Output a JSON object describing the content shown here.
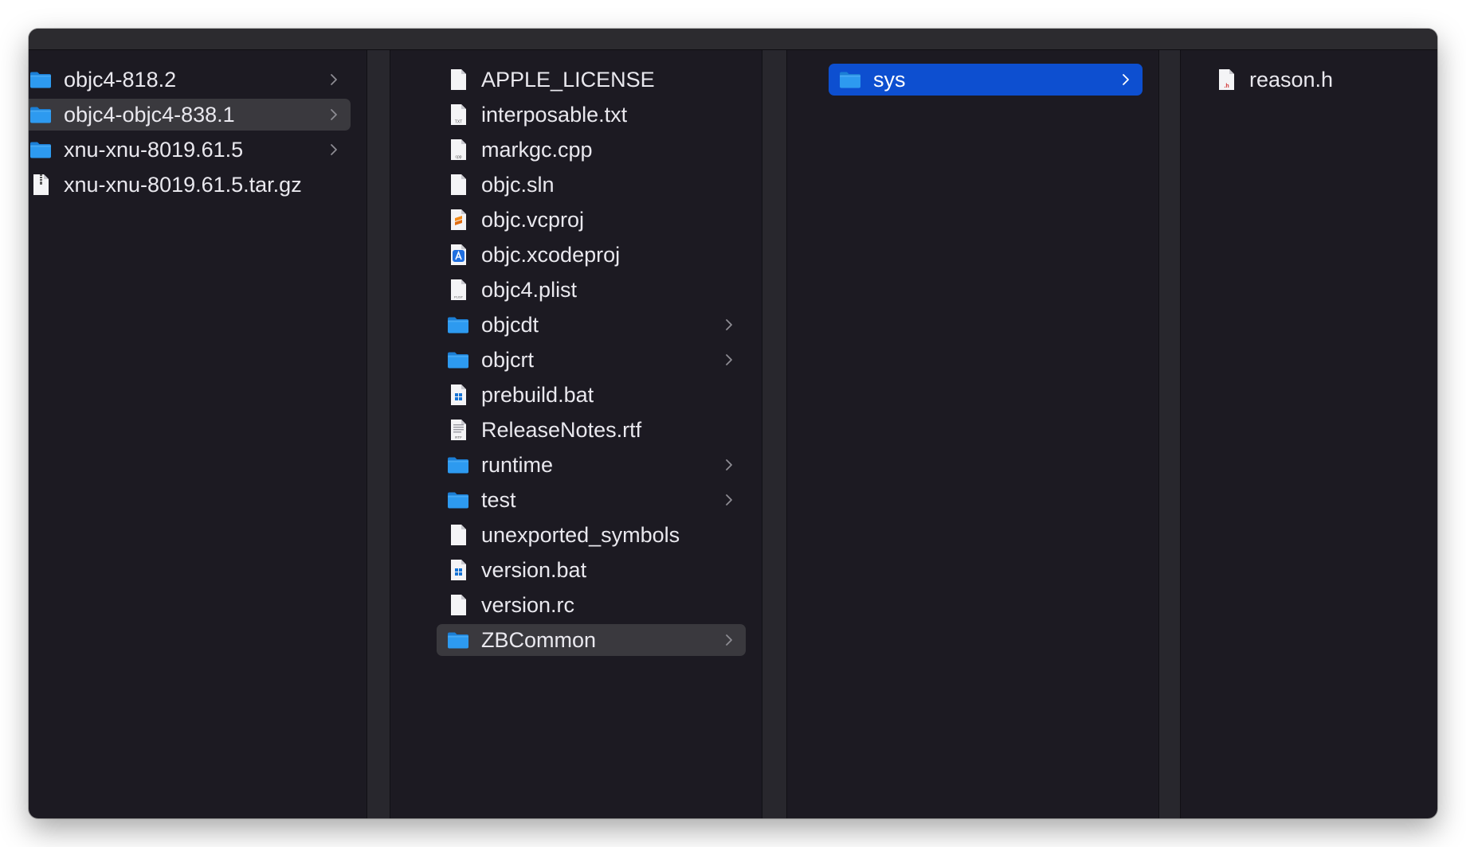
{
  "window": {
    "title": ""
  },
  "colors": {
    "background": "#1c1a22",
    "selection_active": "#0d4fd0",
    "selection_inactive": "#3a393e",
    "folder": "#2d9af0"
  },
  "columns": [
    {
      "items": [
        {
          "name": "objc4-818.2",
          "kind": "folder",
          "chevron": true
        },
        {
          "name": "objc4-objc4-838.1",
          "kind": "folder",
          "chevron": true,
          "selected": "inactive"
        },
        {
          "name": "xnu-xnu-8019.61.5",
          "kind": "folder",
          "chevron": true
        },
        {
          "name": "xnu-xnu-8019.61.5.tar.gz",
          "kind": "archive-icon",
          "chevron": false
        }
      ]
    },
    {
      "items": [
        {
          "name": "APPLE_LICENSE",
          "kind": "document-icon"
        },
        {
          "name": "interposable.txt",
          "kind": "text-file-icon",
          "badge": "TXT"
        },
        {
          "name": "markgc.cpp",
          "kind": "cpp-file-icon",
          "badge": "cpp"
        },
        {
          "name": "objc.sln",
          "kind": "document-icon"
        },
        {
          "name": "objc.vcproj",
          "kind": "sublime-file-icon"
        },
        {
          "name": "objc.xcodeproj",
          "kind": "xcode-project-icon"
        },
        {
          "name": "objc4.plist",
          "kind": "plist-file-icon",
          "badge": "PLIST"
        },
        {
          "name": "objcdt",
          "kind": "folder",
          "chevron": true
        },
        {
          "name": "objcrt",
          "kind": "folder",
          "chevron": true
        },
        {
          "name": "prebuild.bat",
          "kind": "bat-file-icon"
        },
        {
          "name": "ReleaseNotes.rtf",
          "kind": "rtf-file-icon",
          "badge": "RTF"
        },
        {
          "name": "runtime",
          "kind": "folder",
          "chevron": true
        },
        {
          "name": "test",
          "kind": "folder",
          "chevron": true
        },
        {
          "name": "unexported_symbols",
          "kind": "document-icon"
        },
        {
          "name": "version.bat",
          "kind": "bat-file-icon"
        },
        {
          "name": "version.rc",
          "kind": "document-icon"
        },
        {
          "name": "ZBCommon",
          "kind": "folder",
          "chevron": true,
          "selected": "inactive"
        }
      ]
    },
    {
      "items": [
        {
          "name": "sys",
          "kind": "folder",
          "chevron": true,
          "selected": "active"
        }
      ]
    },
    {
      "items": [
        {
          "name": "reason.h",
          "kind": "header-file-icon",
          "badge": ".h"
        }
      ]
    }
  ]
}
